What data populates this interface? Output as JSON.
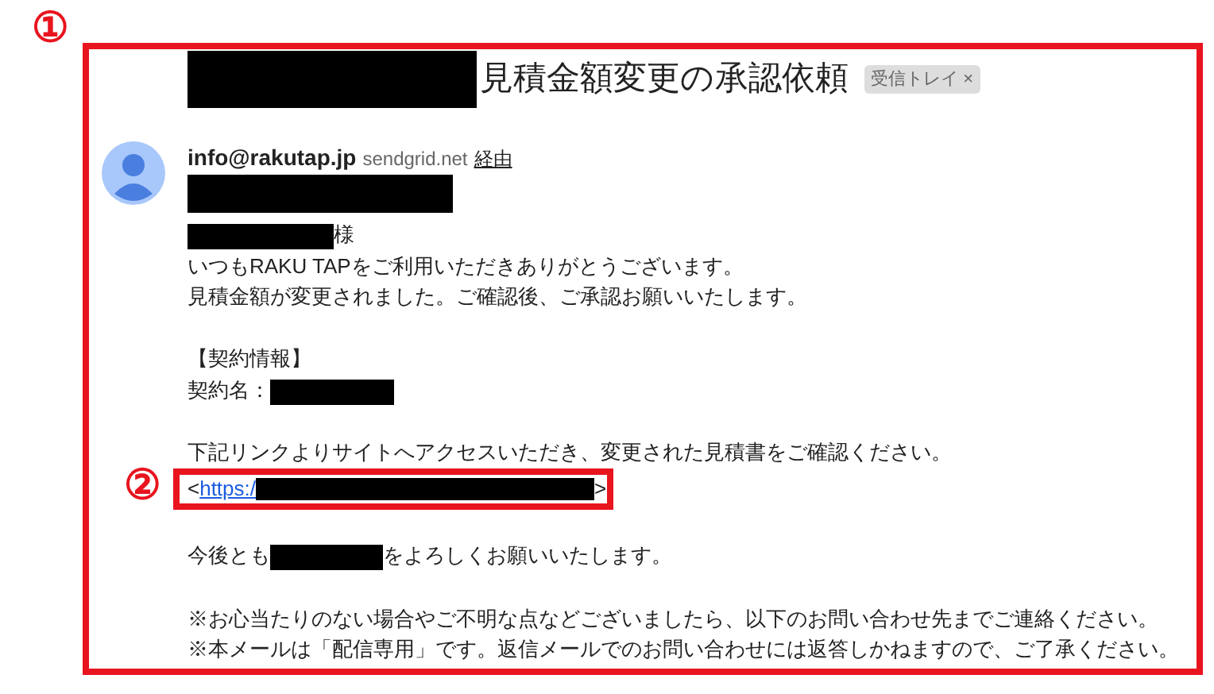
{
  "annotations": [
    {
      "label": "①"
    },
    {
      "label": "②"
    }
  ],
  "subject": {
    "parts": [
      {
        "kind": "redacted"
      },
      {
        "kind": "text",
        "text": "見積金額変更の承認依頼"
      }
    ],
    "tag": "受信トレイ",
    "tag_close": "×"
  },
  "sender": {
    "email": "info@rakutap.jp",
    "domain": "sendgrid.net",
    "via": "経由",
    "recipient_redacted": true
  },
  "body": [
    {
      "kind": "line",
      "parts": [
        {
          "kind": "redacted"
        },
        {
          "kind": "text",
          "text": "様"
        }
      ]
    },
    {
      "kind": "line",
      "parts": [
        {
          "kind": "text",
          "text": "いつもRAKU TAPをご利用いただきありがとうございます。"
        }
      ]
    },
    {
      "kind": "line",
      "parts": [
        {
          "kind": "text",
          "text": "見積金額が変更されました。ご確認後、ご承認お願いいたします。"
        }
      ]
    },
    {
      "kind": "gap"
    },
    {
      "kind": "line",
      "parts": [
        {
          "kind": "text",
          "text": "【契約情報】"
        }
      ]
    },
    {
      "kind": "line",
      "parts": [
        {
          "kind": "text",
          "text": "契約名："
        },
        {
          "kind": "redacted"
        }
      ]
    },
    {
      "kind": "gap"
    },
    {
      "kind": "line",
      "parts": [
        {
          "kind": "text",
          "text": "下記リンクよりサイトへアクセスいただき、変更された見積書をご確認ください。"
        }
      ]
    },
    {
      "kind": "boxed",
      "parts": [
        {
          "kind": "text",
          "text": "<"
        },
        {
          "kind": "link",
          "text": "https:/"
        },
        {
          "kind": "redacted"
        },
        {
          "kind": "text",
          "text": ">"
        }
      ]
    },
    {
      "kind": "gap"
    },
    {
      "kind": "line",
      "parts": [
        {
          "kind": "text",
          "text": "今後とも"
        },
        {
          "kind": "redacted"
        },
        {
          "kind": "text",
          "text": "をよろしくお願いいたします。"
        }
      ]
    },
    {
      "kind": "gap"
    },
    {
      "kind": "line",
      "parts": [
        {
          "kind": "text",
          "text": "※お心当たりのない場合やご不明な点などございましたら、以下のお問い合わせ先までご連絡ください。"
        }
      ]
    },
    {
      "kind": "line",
      "parts": [
        {
          "kind": "text",
          "text": "※本メールは「配信専用」です。返信メールでのお問い合わせには返答しかねますので、ご了承ください。"
        }
      ]
    }
  ]
}
